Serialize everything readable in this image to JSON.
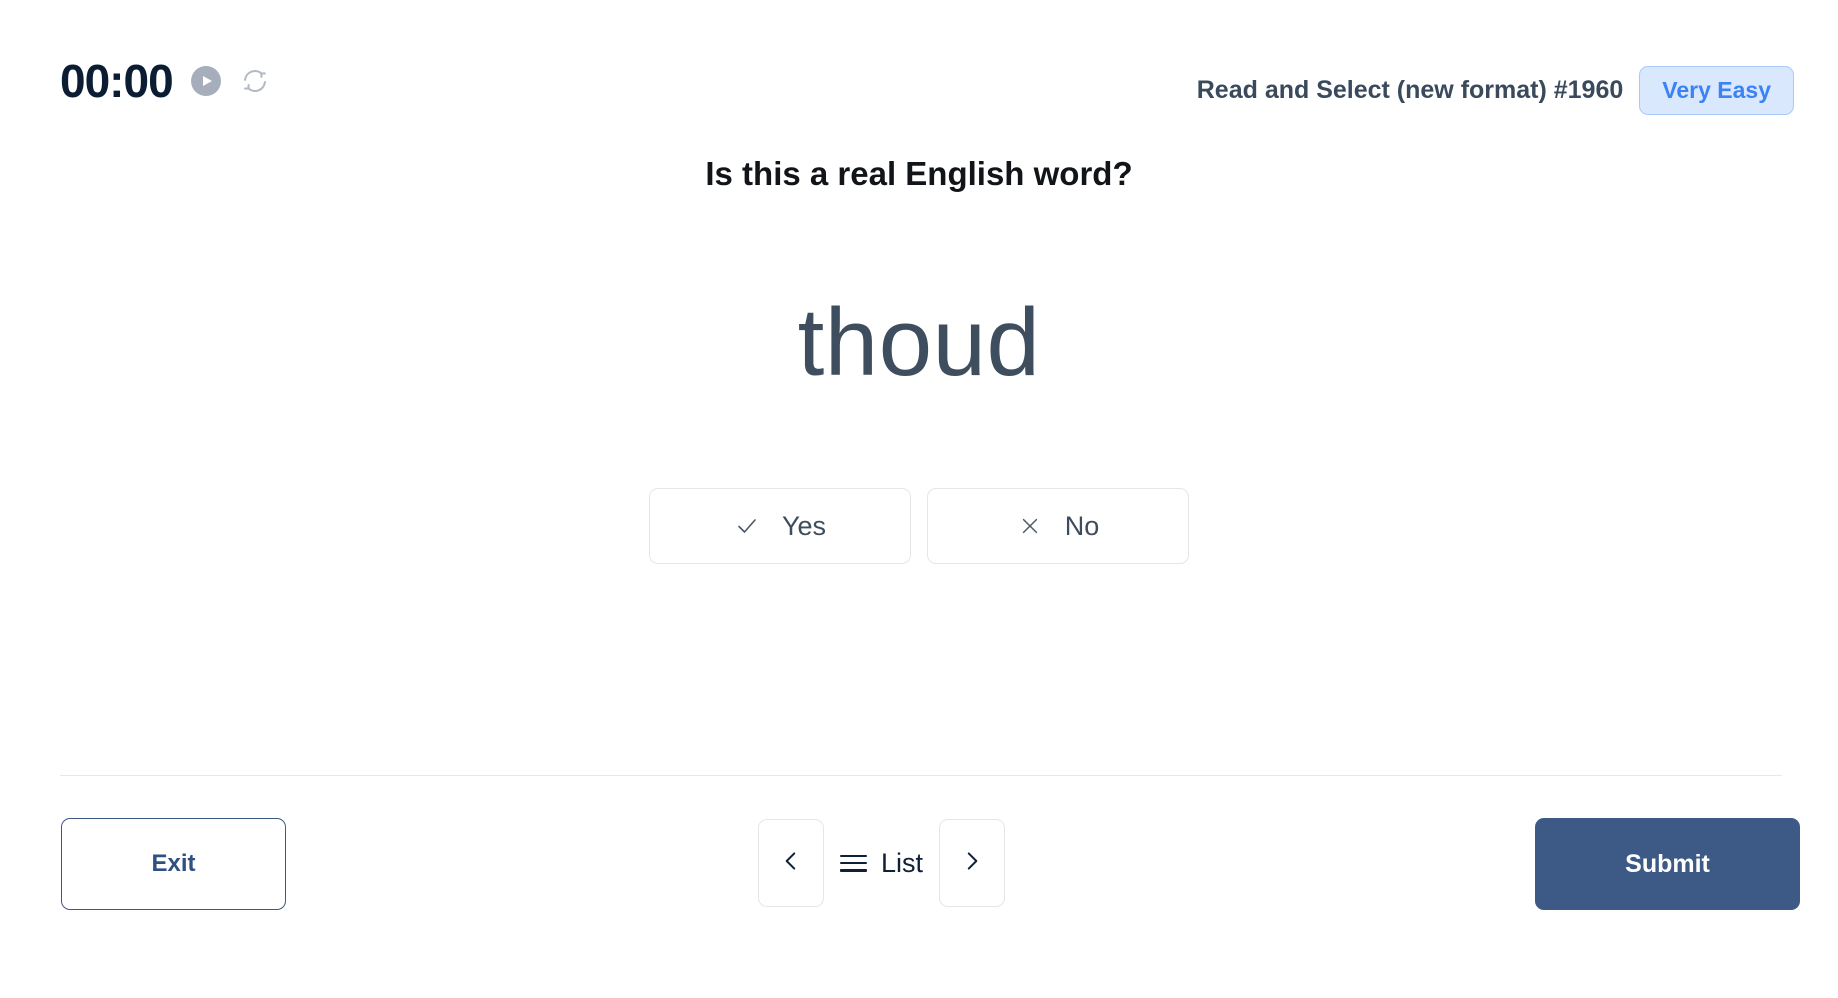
{
  "header": {
    "timer": "00:00",
    "play_icon": "play-icon",
    "refresh_icon": "refresh-icon",
    "task_title": "Read and Select (new format) #1960",
    "difficulty": "Very Easy"
  },
  "question": {
    "prompt": "Is this a real English word?",
    "word": "thoud"
  },
  "answers": [
    {
      "label": "Yes",
      "icon": "check-icon"
    },
    {
      "label": "No",
      "icon": "cross-icon"
    }
  ],
  "footer": {
    "exit_label": "Exit",
    "prev_icon": "chevron-left-icon",
    "list_label": "List",
    "list_icon": "hamburger-icon",
    "next_icon": "chevron-right-icon",
    "submit_label": "Submit"
  },
  "colors": {
    "accent": "#3c5a85",
    "badge_text": "#3b82f6",
    "badge_bg": "#d9e8fd",
    "word": "#3e4e5e",
    "timer": "#0b1c33"
  }
}
